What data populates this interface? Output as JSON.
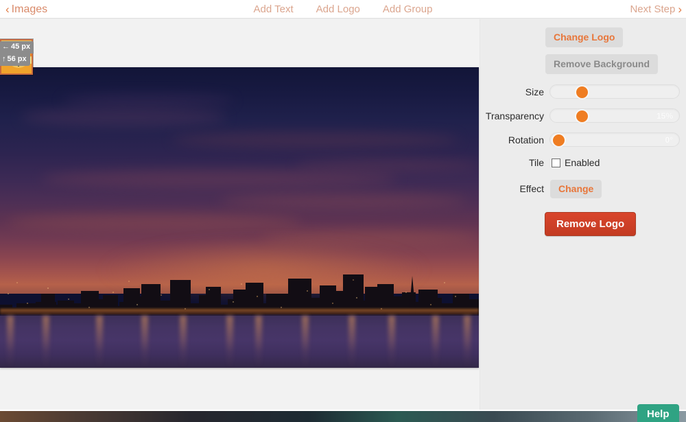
{
  "topnav": {
    "back_label": "Images",
    "back_icon": "chevron-left-icon",
    "links": [
      {
        "label": "Add Text"
      },
      {
        "label": "Add Logo"
      },
      {
        "label": "Add Group"
      }
    ],
    "next_label": "Next Step",
    "next_icon": "chevron-right-icon"
  },
  "canvas": {
    "position_badges": [
      {
        "arrow": "←",
        "value": "45 px"
      },
      {
        "arrow": "↑",
        "value": "56 px"
      }
    ],
    "logo_object": {
      "name": "logo-overlay",
      "cursor_icon": "move-cursor-icon"
    },
    "image": {
      "alt": "City skyline at dusk over water"
    }
  },
  "panel": {
    "change_logo_label": "Change Logo",
    "remove_background_label": "Remove Background",
    "rows": [
      {
        "label": "Size",
        "value": "",
        "knob_percent": 21
      },
      {
        "label": "Transparency",
        "value": "15%",
        "knob_percent": 21
      },
      {
        "label": "Rotation",
        "value": "0°",
        "knob_percent": 1
      }
    ],
    "tile": {
      "label": "Tile",
      "checkbox_label": "Enabled",
      "checked": false
    },
    "effect": {
      "label": "Effect",
      "button_label": "Change"
    },
    "remove_logo_label": "Remove Logo"
  },
  "help": {
    "label": "Help"
  },
  "colors": {
    "accent_orange": "#e8763a",
    "slider_knob": "#ef7d22",
    "danger_red": "#d9452c",
    "help_green": "#2fa383",
    "panel_bg": "#ececec",
    "nav_link": "#dba58e"
  }
}
